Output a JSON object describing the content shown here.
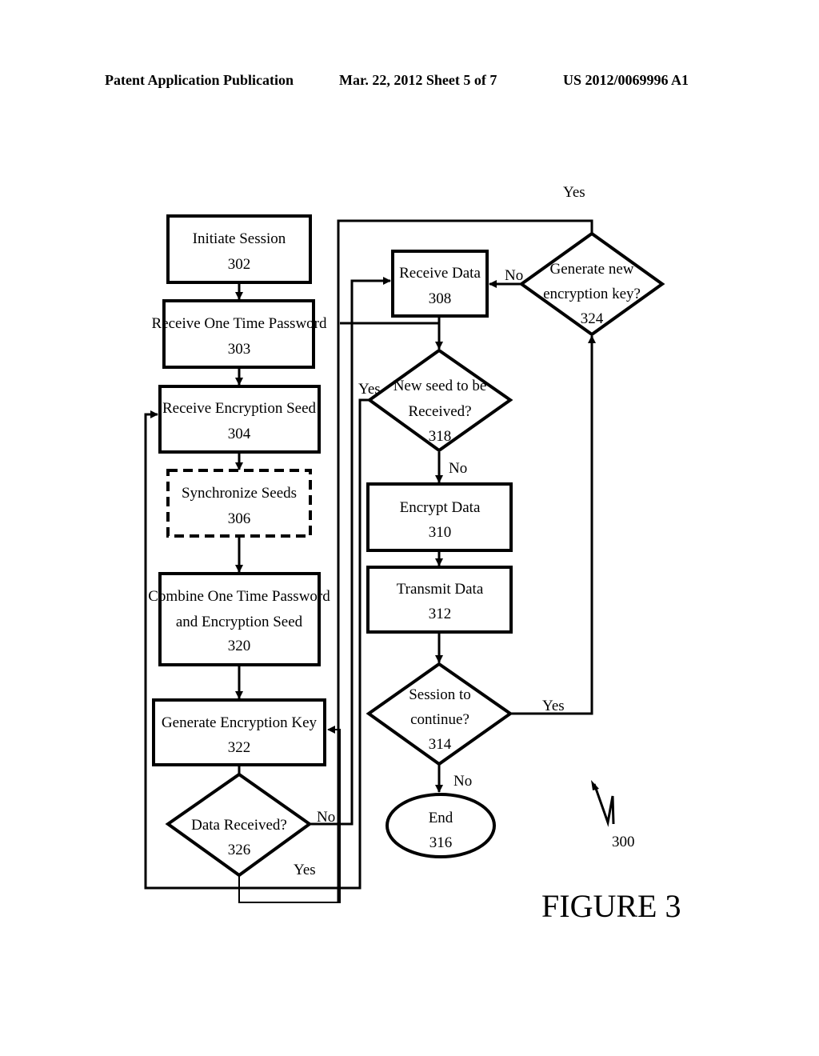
{
  "header": {
    "publication": "Patent Application Publication",
    "date_sheet": "Mar. 22, 2012  Sheet 5 of 7",
    "number": "US 2012/0069996 A1"
  },
  "figure": {
    "label": "FIGURE 3",
    "ref": "300"
  },
  "nodes": {
    "n302": {
      "line1": "Initiate Session",
      "num": "302"
    },
    "n303": {
      "line1": "Receive One Time Password",
      "num": "303"
    },
    "n304": {
      "line1": "Receive Encryption Seed",
      "num": "304"
    },
    "n306": {
      "line1": "Synchronize Seeds",
      "num": "306"
    },
    "n320": {
      "line1": "Combine One Time Password",
      "line2": "and Encryption Seed",
      "num": "320"
    },
    "n322": {
      "line1": "Generate Encryption Key",
      "num": "322"
    },
    "n326": {
      "line1": "Data Received?",
      "num": "326"
    },
    "n308": {
      "line1": "Receive Data",
      "num": "308"
    },
    "n318": {
      "line1": "New seed to be",
      "line2": "Received?",
      "num": "318"
    },
    "n310": {
      "line1": "Encrypt Data",
      "num": "310"
    },
    "n312": {
      "line1": "Transmit Data",
      "num": "312"
    },
    "n314": {
      "line1": "Session to",
      "line2": "continue?",
      "num": "314"
    },
    "n316": {
      "line1": "End",
      "num": "316"
    },
    "n324": {
      "line1": "Generate new",
      "line2": "encryption key?",
      "num": "324"
    }
  },
  "edge_labels": {
    "yes_324": "Yes",
    "no_324": "No",
    "yes_318": "Yes",
    "no_318": "No",
    "yes_314": "Yes",
    "no_314": "No",
    "no_326": "No",
    "yes_326": "Yes"
  }
}
